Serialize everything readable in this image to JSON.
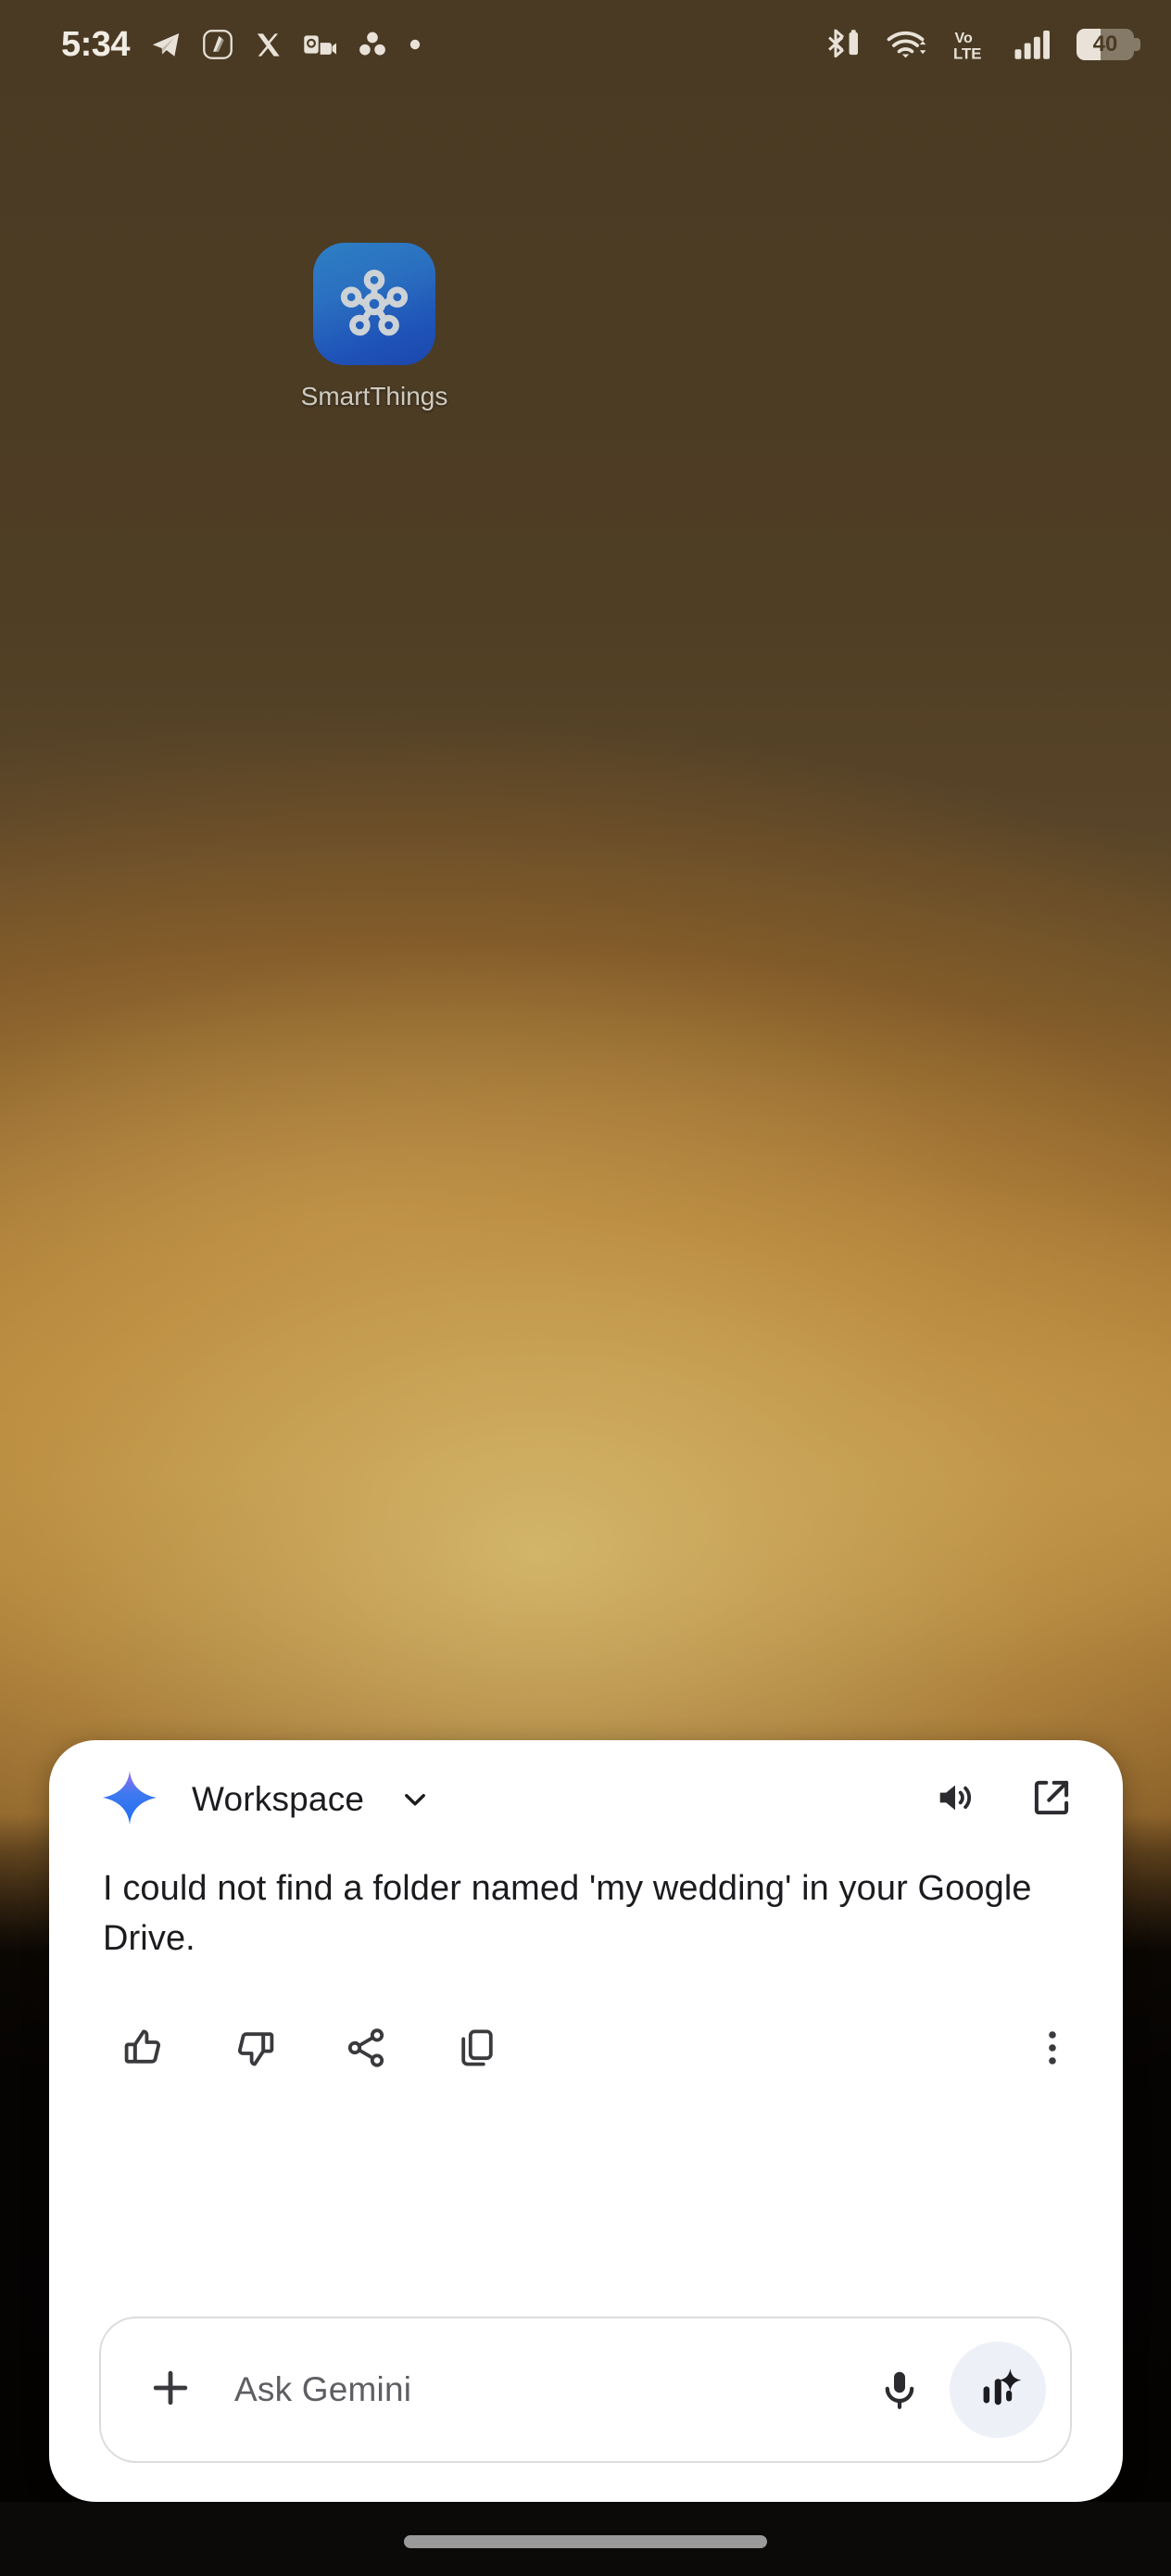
{
  "status_bar": {
    "time": "5:34",
    "notification_icons": [
      {
        "name": "telegram-icon"
      },
      {
        "name": "app-notification-icon"
      },
      {
        "name": "x-twitter-icon"
      },
      {
        "name": "outlook-meeting-icon"
      },
      {
        "name": "asana-icon"
      },
      {
        "name": "more-notifications-dot-icon"
      }
    ],
    "system_icons": [
      {
        "name": "bluetooth-battery-icon"
      },
      {
        "name": "wifi-icon"
      },
      {
        "name": "volte-icon",
        "label_top": "Vo",
        "label_bottom": "LTE"
      },
      {
        "name": "cellular-signal-icon"
      },
      {
        "name": "battery-icon"
      }
    ],
    "battery_percent": "40"
  },
  "home_screen": {
    "app_icon": {
      "label": "SmartThings",
      "icon_name": "smartthings-icon"
    }
  },
  "gemini_panel": {
    "header": {
      "sparkle_icon": "gemini-sparkle-icon",
      "title": "Workspace",
      "chevron_icon": "chevron-down-icon",
      "speaker_icon": "volume-up-icon",
      "expand_icon": "open-in-new-icon"
    },
    "response": {
      "text": "I could not find a folder named 'my wedding' in your Google Drive."
    },
    "actions": [
      {
        "name": "thumb-up-icon"
      },
      {
        "name": "thumb-down-icon"
      },
      {
        "name": "share-icon"
      },
      {
        "name": "copy-icon"
      },
      {
        "name": "more-vert-icon"
      }
    ],
    "input": {
      "plus_icon": "add-icon",
      "placeholder": "Ask Gemini",
      "value": "",
      "mic_icon": "microphone-icon",
      "live_icon": "gemini-live-icon"
    }
  },
  "navigation": {
    "pill_name": "home-gesture-pill"
  },
  "colors": {
    "panel_background": "#ffffff",
    "text_primary": "#1c1b1f",
    "placeholder": "#5e5e63",
    "gemini_blue": "#2f6bef",
    "gemini_purple": "#8a5cf0",
    "smartthings_blue": "#1f54b8",
    "live_button_bg": "#eef0f8",
    "nav_pill": "#9a9a9a"
  }
}
